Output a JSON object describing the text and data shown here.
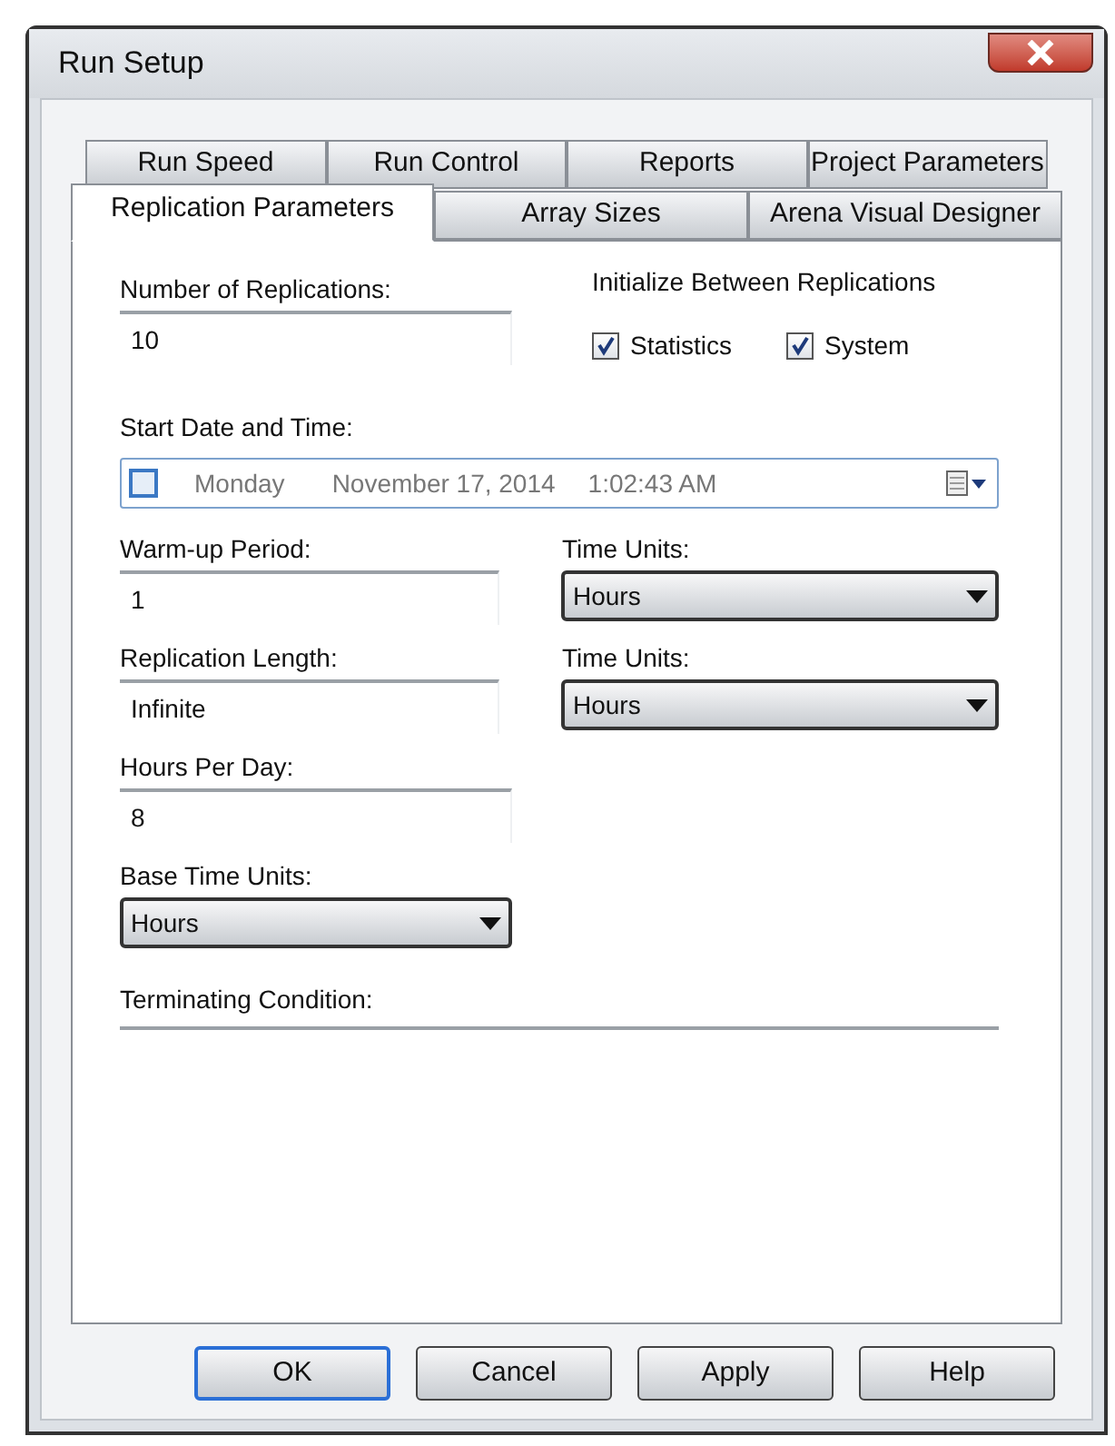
{
  "window": {
    "title": "Run Setup"
  },
  "tab_rows": [
    [
      {
        "label": "Run Speed",
        "selected": false
      },
      {
        "label": "Run Control",
        "selected": false
      },
      {
        "label": "Reports",
        "selected": false
      },
      {
        "label": "Project Parameters",
        "selected": false
      }
    ],
    [
      {
        "label": "Replication Parameters",
        "selected": true
      },
      {
        "label": "Array Sizes",
        "selected": false
      },
      {
        "label": "Arena Visual Designer",
        "selected": false
      }
    ]
  ],
  "replications": {
    "label": "Number of Replications:",
    "value": "10"
  },
  "initialize": {
    "label": "Initialize Between Replications",
    "checkboxes": [
      {
        "label": "Statistics",
        "checked": true
      },
      {
        "label": "System",
        "checked": true
      }
    ]
  },
  "start": {
    "label": "Start Date and Time:",
    "checked": false,
    "day": "Monday",
    "date": "November 17, 2014",
    "time": "1:02:43 AM"
  },
  "rows": [
    {
      "left": {
        "kind": "text",
        "label": "Warm-up Period:",
        "value": "1"
      },
      "right": {
        "kind": "dropdown",
        "label": "Time Units:",
        "value": "Hours"
      }
    },
    {
      "left": {
        "kind": "text",
        "label": "Replication Length:",
        "value": "Infinite"
      },
      "right": {
        "kind": "dropdown",
        "label": "Time Units:",
        "value": "Hours"
      }
    },
    {
      "left": {
        "kind": "text",
        "label": "Hours Per Day:",
        "value": "8"
      }
    },
    {
      "left": {
        "kind": "dropdown",
        "label": "Base Time Units:",
        "value": "Hours"
      }
    }
  ],
  "terminating": {
    "label": "Terminating Condition:"
  },
  "buttons": [
    {
      "label": "OK",
      "default": true
    },
    {
      "label": "Cancel",
      "default": false
    },
    {
      "label": "Apply",
      "default": false
    },
    {
      "label": "Help",
      "default": false
    }
  ]
}
